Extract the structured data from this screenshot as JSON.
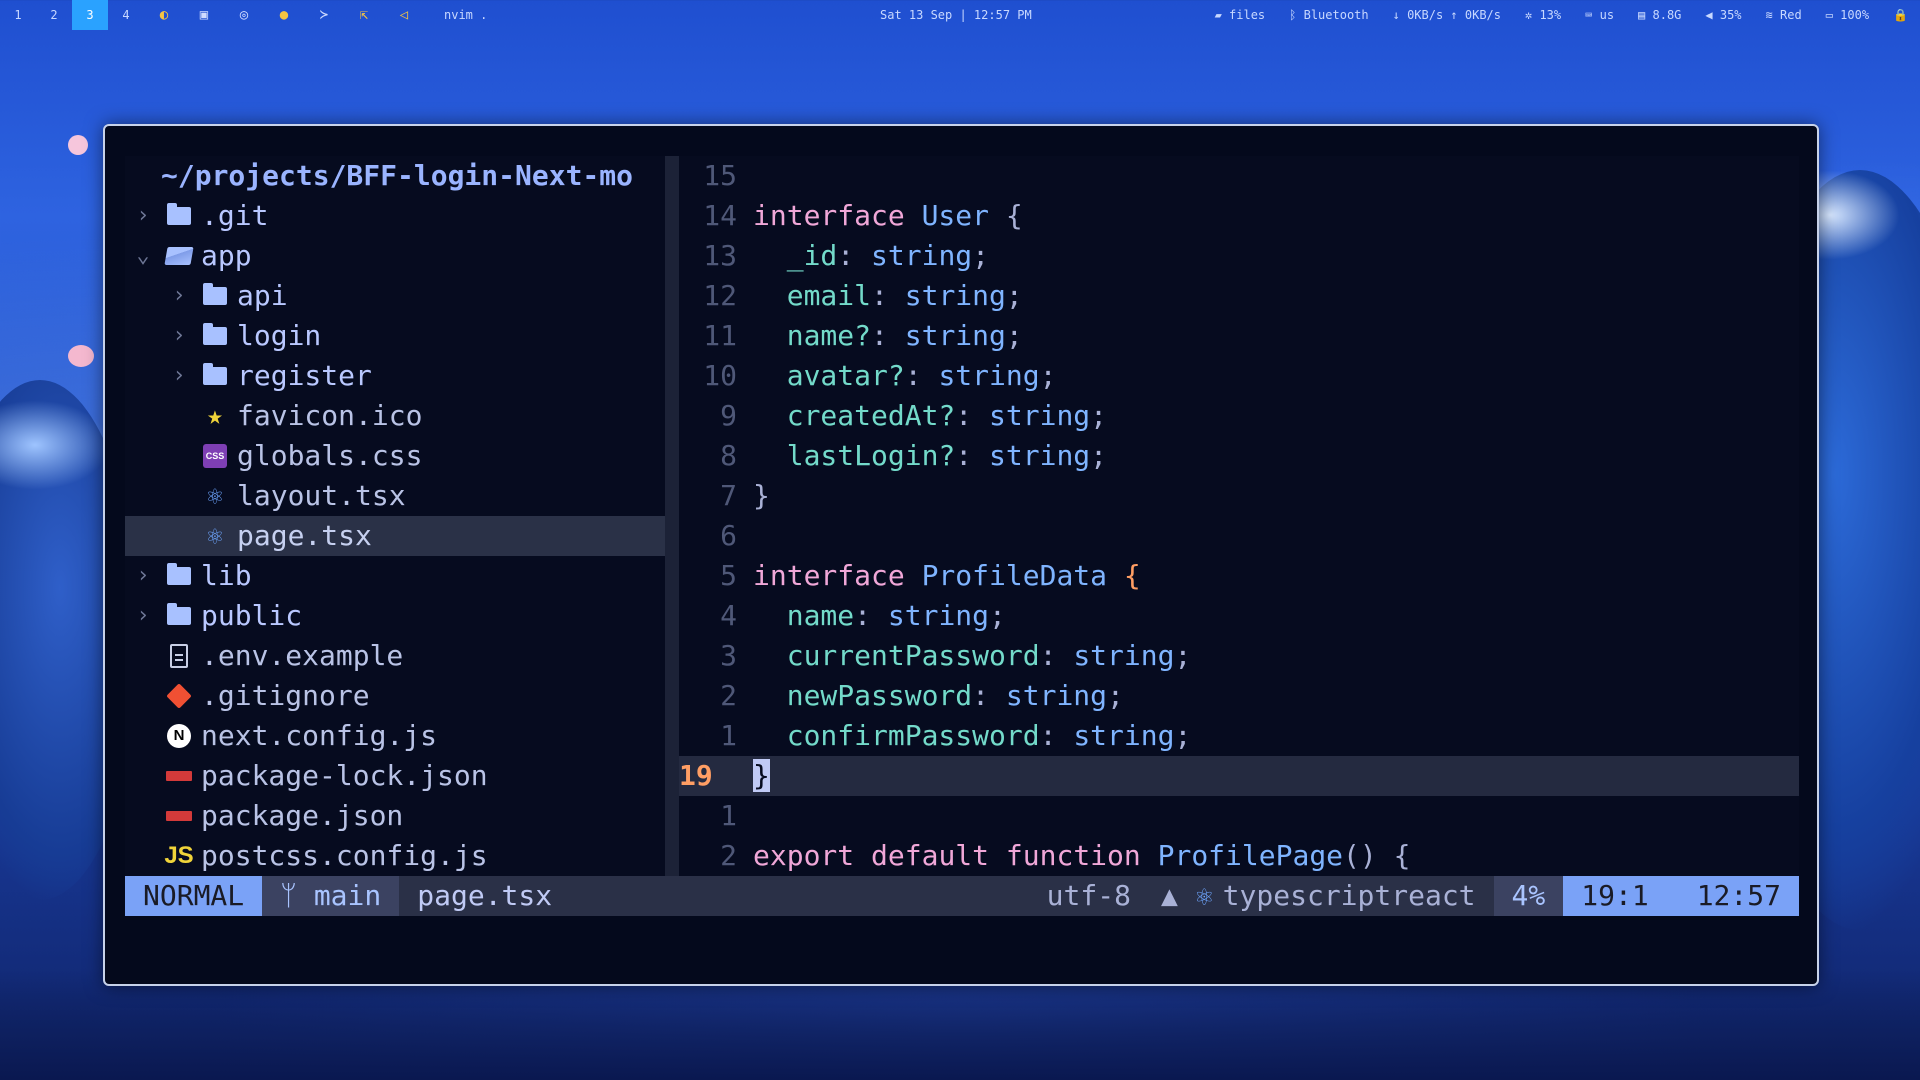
{
  "topbar": {
    "workspaces": [
      "1",
      "2",
      "3",
      "4"
    ],
    "active_workspace": "3",
    "app_title": "nvim .",
    "clock": "Sat 13 Sep | 12:57 PM",
    "files": "files",
    "bluetooth": "Bluetooth",
    "network_speed": "↓ 0KB/s ↑ 0KB/s",
    "cpu": "13%",
    "keyboard_layout": "us",
    "memory": "8.8G",
    "volume": "35%",
    "wifi": "Red",
    "battery": "100%"
  },
  "tree": {
    "root": "~/projects/BFF-login-Next-mo",
    "items": [
      {
        "label": ".git"
      },
      {
        "label": "app"
      },
      {
        "label": "api"
      },
      {
        "label": "login"
      },
      {
        "label": "register"
      },
      {
        "label": "favicon.ico"
      },
      {
        "label": "globals.css"
      },
      {
        "label": "layout.tsx"
      },
      {
        "label": "page.tsx"
      },
      {
        "label": "lib"
      },
      {
        "label": "public"
      },
      {
        "label": ".env.example"
      },
      {
        "label": ".gitignore"
      },
      {
        "label": "next.config.js"
      },
      {
        "label": "package-lock.json"
      },
      {
        "label": "package.json"
      },
      {
        "label": "postcss.config.js"
      }
    ]
  },
  "editor": {
    "line_numbers": [
      "15",
      "14",
      "13",
      "12",
      "11",
      "10",
      "9",
      "8",
      "7",
      "6",
      "5",
      "4",
      "3",
      "2",
      "1",
      "19",
      "1",
      "2"
    ],
    "code": {
      "kw_interface": "interface",
      "user_type": "User",
      "open_brace": "{",
      "close_brace": "}",
      "semi": ";",
      "string_type": "string",
      "id": "_id",
      "email": "email",
      "name_opt": "name?",
      "avatar": "avatar?",
      "createdAt": "createdAt?",
      "lastLogin": "lastLogin?",
      "profile_type": "ProfileData",
      "name": "name",
      "currentPassword": "currentPassword",
      "newPassword": "newPassword",
      "confirmPassword": "confirmPassword",
      "kw_export": "export",
      "kw_default": "default",
      "kw_function": "function",
      "fn_name": "ProfilePage",
      "parens": "()"
    }
  },
  "statusline": {
    "mode": "NORMAL",
    "branch": "main",
    "filename": "page.tsx",
    "encoding": "utf-8",
    "filetype": "typescriptreact",
    "percent": "4%",
    "position": "19:1",
    "time": "12:57"
  },
  "colors": {
    "accent": "#7aa2f7",
    "active_workspace": "#2aa2ff",
    "current_line_number": "#ff9e64",
    "keyword": "#f0a7d8",
    "type": "#7fb4ff",
    "property": "#73daca"
  }
}
